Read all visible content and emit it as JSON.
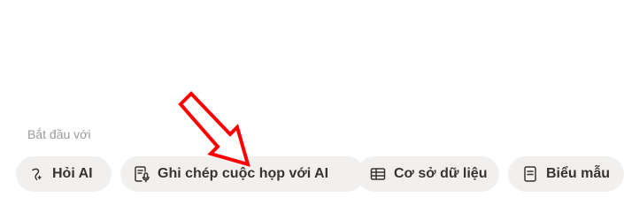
{
  "start_with": {
    "label": "Bắt đầu với",
    "chips": [
      {
        "label": "Hỏi AI",
        "icon": "ai-sparkle-icon"
      },
      {
        "label": "Ghi chép cuộc họp với AI",
        "icon": "meeting-notes-icon"
      },
      {
        "label": "Cơ sở dữ liệu",
        "icon": "table-icon"
      },
      {
        "label": "Biểu mẫu",
        "icon": "form-icon"
      }
    ]
  },
  "annotation": {
    "arrow_color": "#ff0000",
    "points_to": "Ghi chép cuộc họp với AI"
  },
  "colors": {
    "chip_background": "#f1f0ee",
    "chip_text": "#37352f",
    "label_text": "#9b9a97"
  }
}
